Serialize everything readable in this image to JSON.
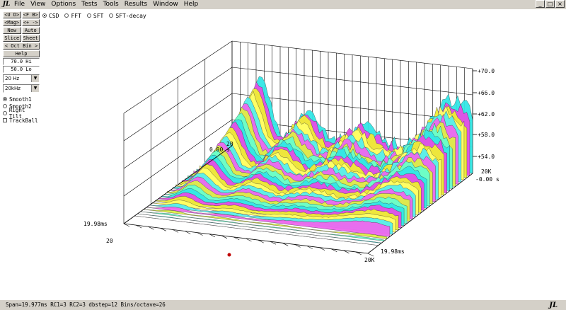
{
  "menu": [
    "File",
    "View",
    "Options",
    "Tests",
    "Tools",
    "Results",
    "Window",
    "Help"
  ],
  "logo_text": "JL",
  "left_panel": {
    "nav_rows": [
      [
        "<U D>",
        "<F B>"
      ],
      [
        "<Mag>",
        "<+ ->"
      ],
      [
        "New",
        "Auto"
      ],
      [
        "Slice",
        "Sheet"
      ]
    ],
    "oct_bin": "< Oct Bin >",
    "help": "Help",
    "hi_value": "70.0 Hi",
    "lo_value": "50.0 Lo",
    "low_freq": "20 Hz",
    "high_freq": "20kHz",
    "options": [
      {
        "label": "Smooth1",
        "type": "radio",
        "checked": true
      },
      {
        "label": "Smooth2",
        "type": "radio",
        "checked": false
      },
      {
        "label": "Right Tilt",
        "type": "radio",
        "checked": false
      },
      {
        "label": "TrackBall",
        "type": "checkbox",
        "checked": false
      }
    ]
  },
  "modes": [
    {
      "label": "CSD",
      "checked": true
    },
    {
      "label": "FFT",
      "checked": false
    },
    {
      "label": "SFT",
      "checked": false
    },
    {
      "label": "SFT-decay",
      "checked": false
    }
  ],
  "plot": {
    "z_ticks": [
      "+70.0",
      "+66.0",
      "+62.0",
      "+58.0",
      "+54.0"
    ],
    "time_top_back": "0.00 s",
    "time_top_right": "-0.00 s",
    "time_bottom_left": "19.98ms",
    "time_bottom_right": "19.98ms",
    "freq_left": "20",
    "freq_left_back": "20",
    "freq_right": "20K",
    "freq_right_back": "20K"
  },
  "status": {
    "text": "Span=19.977ms  RC1=3  RC2=3  dbstep=12 Bins/octave=26",
    "logo": "JL"
  }
}
